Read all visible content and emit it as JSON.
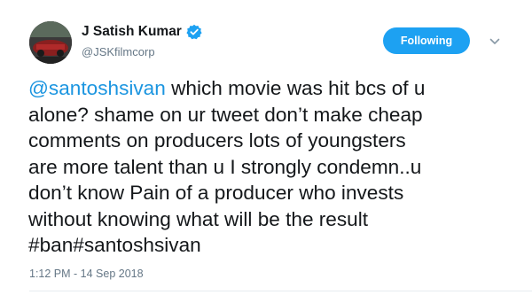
{
  "tweet": {
    "author": {
      "display_name": "J Satish Kumar",
      "handle": "@JSKfilmcorp",
      "verified_icon": "verified-badge-icon",
      "avatar_icon": "profile-photo"
    },
    "follow_button_label": "Following",
    "menu_icon": "chevron-down-icon",
    "body": {
      "mention": "@santoshsivan",
      "line1_rest": " which movie was hit bcs of u",
      "line2": "alone? shame on ur tweet don’t make cheap",
      "line3": "comments on producers lots of youngsters",
      "line4": "are more talent than u I strongly condemn..u",
      "line5": "don’t know Pain of a producer who invests",
      "line6": "without knowing what will be the result",
      "line7": "#ban#santoshsivan"
    },
    "timestamp": "1:12 PM - 14 Sep 2018"
  },
  "colors": {
    "accent": "#1da1f2",
    "link": "#1b95e0",
    "text": "#14171a",
    "muted": "#657786"
  }
}
